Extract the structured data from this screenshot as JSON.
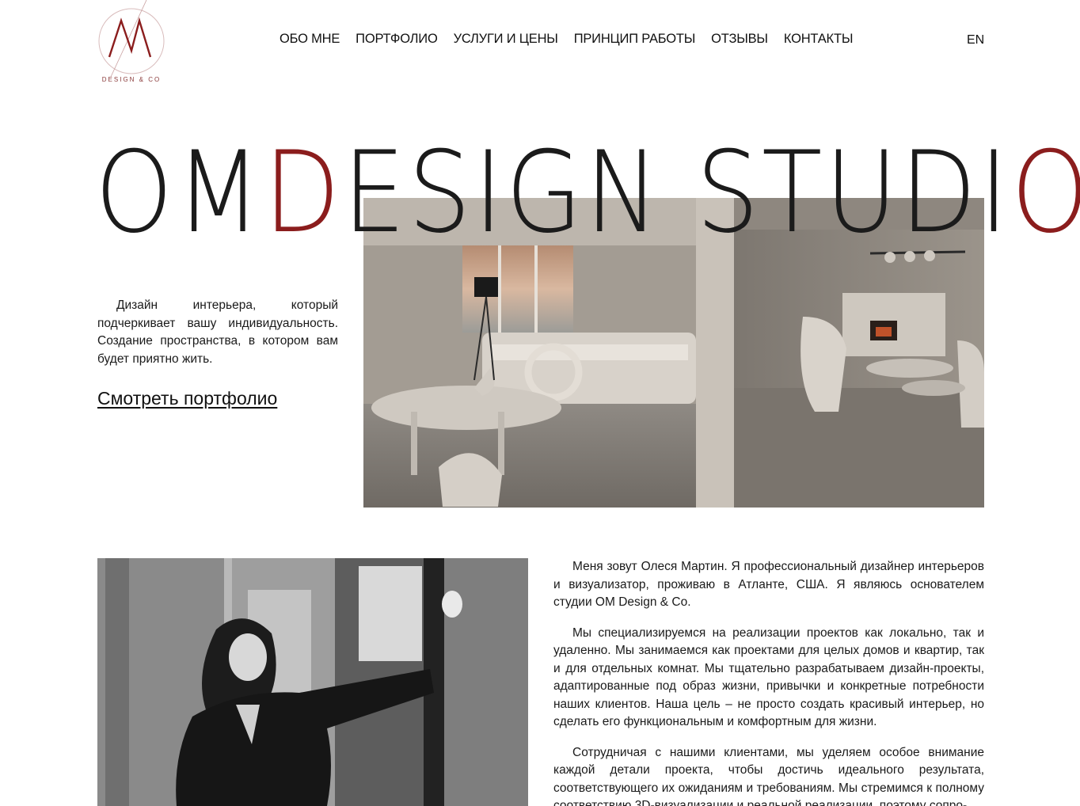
{
  "brand": {
    "logo_text": "DESIGN & CO",
    "accent_color": "#8b1d1d"
  },
  "nav": {
    "items": [
      {
        "label": "ОБО МНЕ"
      },
      {
        "label": "ПОРТФОЛИО"
      },
      {
        "label": "УСЛУГИ И ЦЕНЫ"
      },
      {
        "label": "ПРИНЦИП РАБОТЫ"
      },
      {
        "label": "ОТЗЫВЫ"
      },
      {
        "label": "КОНТАКТЫ"
      }
    ],
    "language": "EN"
  },
  "hero": {
    "title_part1": "OM",
    "title_accent1": "D",
    "title_part2": "ESIGN STUDI",
    "title_accent2": "O",
    "text": "Дизайн интерьера, который подчеркивает вашу индивидуальность. Создание пространства, в котором вам будет приятно жить.",
    "link_label": "Смотреть портфолио",
    "image_icon": "interior-render-image"
  },
  "about": {
    "photo_icon": "designer-portrait-photo",
    "paragraphs": [
      "Меня зовут Олеся Мартин. Я профессиональный дизайнер интерьеров и визуализатор, проживаю в Атланте, США. Я являюсь основателем студии OM Design & Co.",
      "Мы специализируемся на реализации проектов как локально, так и удаленно. Мы занимаемся как проектами для целых домов и квартир, так и для отдельных комнат. Мы тщательно разрабатываем дизайн-проекты, адаптированные под образ жизни, привычки и конкретные потребности наших клиентов. Наша цель – не просто создать красивый интерьер, но сделать его функциональным и комфортным для жизни.",
      "Сотрудничая с нашими клиентами, мы уделяем особое внимание каждой детали проекта, чтобы достичь идеального результата, соответствующего их ожиданиям и требованиям. Мы стремимся к полному соответствию 3D-визуализации и реальной реализации, поэтому сопро-"
    ]
  }
}
